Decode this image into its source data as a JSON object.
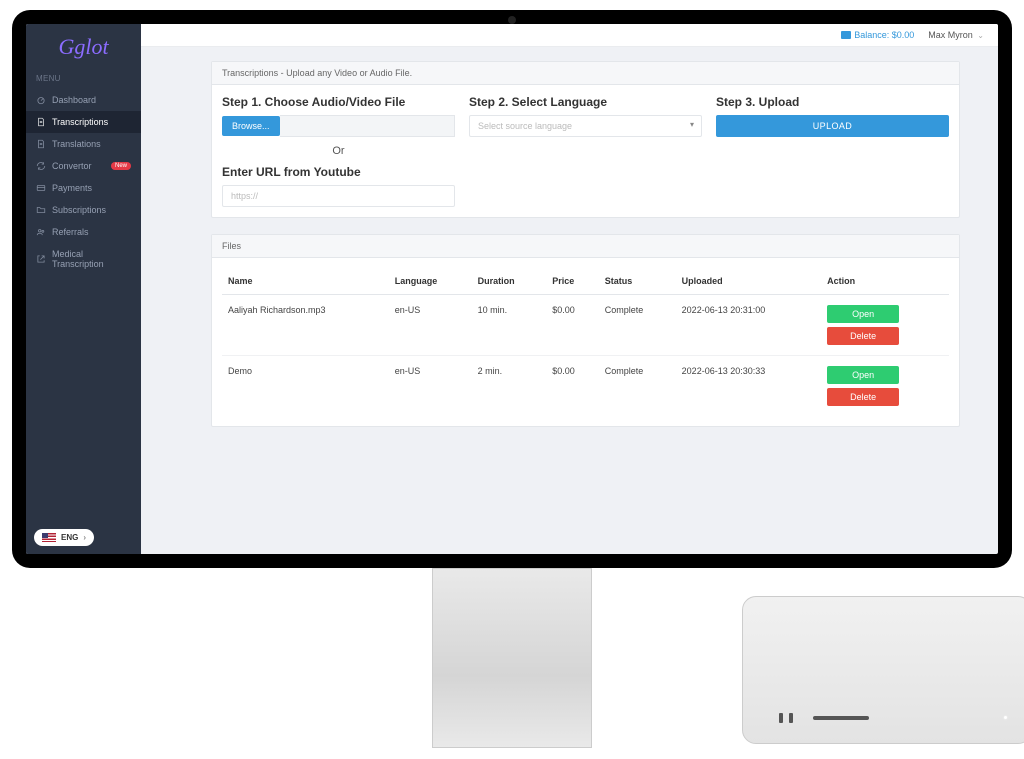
{
  "brand": "Gglot",
  "menu_label": "MENU",
  "sidebar": {
    "items": [
      {
        "label": "Dashboard"
      },
      {
        "label": "Transcriptions"
      },
      {
        "label": "Translations"
      },
      {
        "label": "Convertor"
      },
      {
        "label": "Payments"
      },
      {
        "label": "Subscriptions"
      },
      {
        "label": "Referrals"
      },
      {
        "label": "Medical Transcription"
      }
    ],
    "new_badge": "New"
  },
  "lang": "ENG",
  "header": {
    "balance_label": "Balance: $0.00",
    "user": "Max Myron"
  },
  "upload_panel": {
    "title": "Transcriptions - Upload any Video or Audio File.",
    "step1_title": "Step 1. Choose Audio/Video File",
    "browse_label": "Browse...",
    "or_label": "Or",
    "url_title": "Enter URL from Youtube",
    "url_placeholder": "https://",
    "step2_title": "Step 2. Select Language",
    "select_placeholder": "Select source language",
    "step3_title": "Step 3. Upload",
    "upload_label": "UPLOAD"
  },
  "files_panel": {
    "title": "Files",
    "cols": {
      "name": "Name",
      "language": "Language",
      "duration": "Duration",
      "price": "Price",
      "status": "Status",
      "uploaded": "Uploaded",
      "action": "Action"
    },
    "open_label": "Open",
    "delete_label": "Delete",
    "rows": [
      {
        "name": "Aaliyah Richardson.mp3",
        "language": "en-US",
        "duration": "10 min.",
        "price": "$0.00",
        "status": "Complete",
        "uploaded": "2022-06-13 20:31:00"
      },
      {
        "name": "Demo",
        "language": "en-US",
        "duration": "2 min.",
        "price": "$0.00",
        "status": "Complete",
        "uploaded": "2022-06-13 20:30:33"
      }
    ]
  }
}
